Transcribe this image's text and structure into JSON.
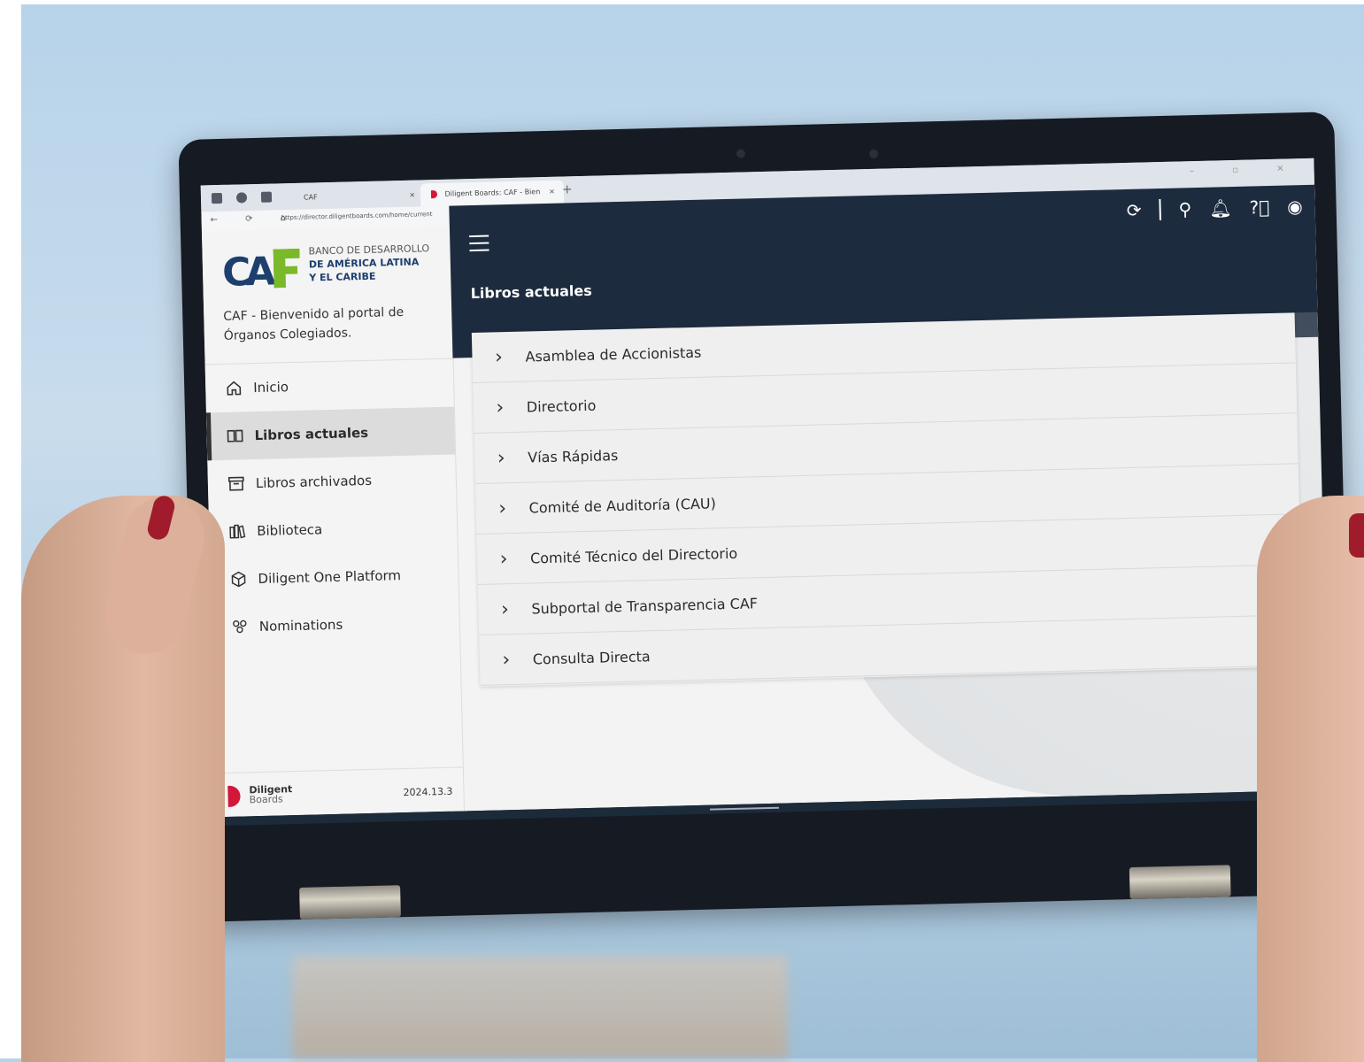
{
  "browser": {
    "inactive_tab": "CAF",
    "active_tab": "Diligent Boards: CAF - Bien",
    "tab_close": "×",
    "new_tab": "+",
    "url": "https://director.diligentboards.com/home/current"
  },
  "brand": {
    "line1": "BANCO DE DESARROLLO",
    "line2": "DE AMÉRICA LATINA",
    "line3": "Y EL CARIBE",
    "logo_colors": {
      "blue": "#1c3f6e",
      "green": "#7ab929"
    }
  },
  "sidebar": {
    "welcome": "CAF - Bienvenido al portal de Órganos Colegiados.",
    "items": [
      {
        "label": "Inicio",
        "icon": "home-icon"
      },
      {
        "label": "Libros actuales",
        "icon": "book-icon",
        "active": true
      },
      {
        "label": "Libros archivados",
        "icon": "archive-icon"
      },
      {
        "label": "Biblioteca",
        "icon": "library-icon"
      },
      {
        "label": "Diligent One Platform",
        "icon": "cube-icon"
      },
      {
        "label": "Nominations",
        "icon": "people-icon"
      }
    ],
    "footer": {
      "brand_line1": "Diligent",
      "brand_line2": "Boards",
      "version": "2024.13.3"
    }
  },
  "main": {
    "title": "Libros actuales",
    "books": [
      "Asamblea de Accionistas",
      "Directorio",
      "Vías Rápidas",
      "Comité de Auditoría (CAU)",
      "Comité Técnico del Directorio",
      "Subportal de Transparencia CAF",
      "Consulta Directa"
    ]
  },
  "colors": {
    "header": "#1d2b3e",
    "diligent_red": "#d3173b"
  }
}
